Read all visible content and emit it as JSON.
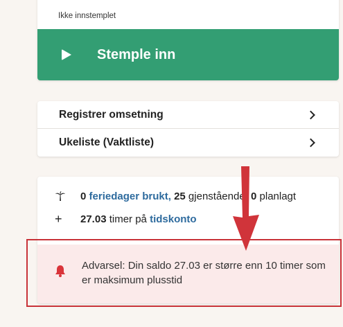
{
  "clock": {
    "status": "Ikke innstemplet",
    "button_label": "Stemple inn",
    "button_color": "#339e73"
  },
  "links": [
    {
      "label": "Registrer omsetning"
    },
    {
      "label": "Ukeliste (Vaktliste)"
    }
  ],
  "vacation": {
    "used_count": "0",
    "used_link": "feriedager brukt,",
    "remaining_count": "25",
    "remaining_text": "gjenstående,",
    "planned_count": "0",
    "planned_text": "planlagt"
  },
  "time_account": {
    "balance": "27.03",
    "text": "timer på",
    "link": "tidskonto"
  },
  "warning": {
    "text": "Advarsel: Din saldo 27.03 er større enn 10 timer som er maksimum plusstid",
    "color": "#d9343a"
  },
  "annotation": {
    "color": "#d0343a"
  }
}
